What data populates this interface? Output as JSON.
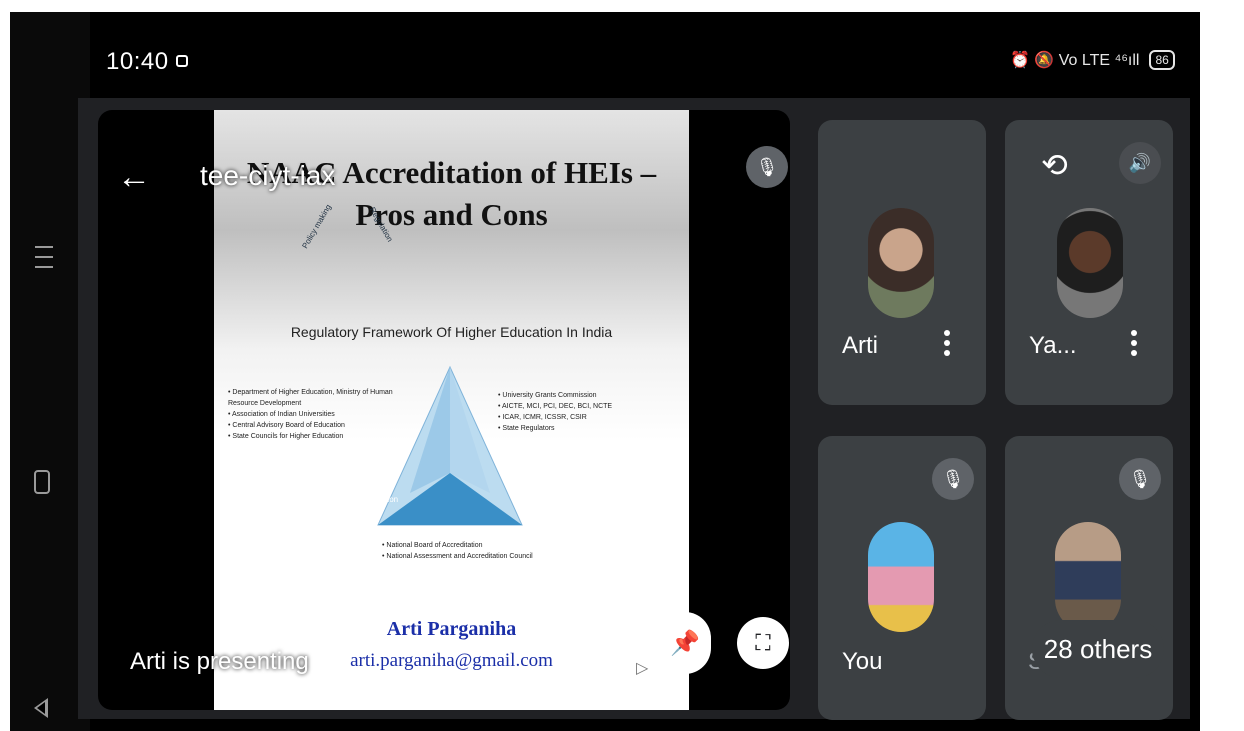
{
  "status_bar": {
    "time": "10:40",
    "status_icons": "⏰ 🔕 Vo LTE ⁴⁶ıll",
    "battery": "86"
  },
  "meeting": {
    "code": "tee-ciyt-iax",
    "presenting_label": "Arti is presenting"
  },
  "slide": {
    "title_line1": "NAAC Accreditation of HEIs –",
    "title_line2": "Pros and Cons",
    "subtitle": "Regulatory Framework Of Higher Education In India",
    "left_bullets": [
      "Department of Higher Education, Ministry of Human Resource Development",
      "Association of Indian Universities",
      "Central Advisory Board of Education",
      "State Councils for Higher Education"
    ],
    "right_bullets": [
      "University Grants Commission",
      "AICTE, MCI, PCI, DEC, BCI, NCTE",
      "ICAR, ICMR, ICSSR, CSIR",
      "State Regulators"
    ],
    "triangle_left": "Policy making",
    "triangle_right": "Regulation",
    "triangle_base": "Accreditation",
    "bottom_bullets": [
      "National Board of Accreditation",
      "National Assessment and Accreditation Council"
    ],
    "presenter_name": "Arti Parganiha",
    "presenter_email": "arti.parganiha@gmail.com"
  },
  "participants": {
    "arti": "Arti",
    "ya": "Ya...",
    "you": "You",
    "others_hidden": "Sa",
    "others_chip": "28 others"
  },
  "colors": {
    "meet_background": "#202124",
    "tile_background": "#3c4043",
    "slide_accent": "#1b2fa8",
    "triangle": "#3a8fc7"
  }
}
